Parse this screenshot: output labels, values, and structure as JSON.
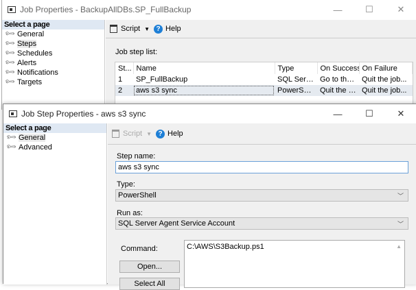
{
  "outer": {
    "title": "Job Properties - BackupAllDBs.SP_FullBackup",
    "select_page": "Select a page",
    "pages": [
      "General",
      "Steps",
      "Schedules",
      "Alerts",
      "Notifications",
      "Targets"
    ],
    "toolbar": {
      "script": "Script",
      "help": "Help"
    },
    "job_step_list_label": "Job step list:",
    "columns": [
      "St...",
      "Name",
      "Type",
      "On Success",
      "On Failure"
    ],
    "rows": [
      [
        "1",
        "SP_FullBackup",
        "SQL Serv...",
        "Go to the ...",
        "Quit the job..."
      ],
      [
        "2",
        "aws s3 sync",
        "PowerShell",
        "Quit the jo...",
        "Quit the job..."
      ]
    ]
  },
  "inner": {
    "title": "Job Step Properties - aws s3 sync",
    "select_page": "Select a page",
    "pages": [
      "General",
      "Advanced"
    ],
    "toolbar": {
      "script": "Script",
      "help": "Help"
    },
    "step_name_label": "Step name:",
    "step_name": "aws s3 sync",
    "type_label": "Type:",
    "type": "PowerShell",
    "run_as_label": "Run as:",
    "run_as": "SQL Server Agent Service Account",
    "command_label": "Command:",
    "command": "C:\\AWS\\S3Backup.ps1",
    "open_button": "Open...",
    "select_all_button": "Select All"
  },
  "window_controls": {
    "minimize": "—",
    "maximize": "☐",
    "close": "✕"
  }
}
